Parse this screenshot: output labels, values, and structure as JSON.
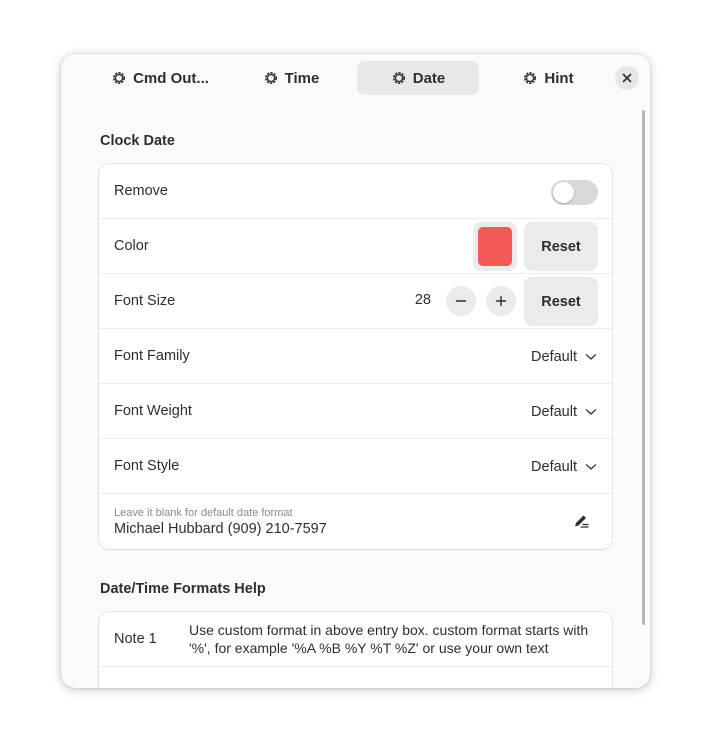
{
  "tabs": [
    {
      "label": "Cmd Out...",
      "icon": "gear-icon",
      "active": false
    },
    {
      "label": "Time",
      "icon": "gear-icon",
      "active": false
    },
    {
      "label": "Date",
      "icon": "gear-icon",
      "active": true
    },
    {
      "label": "Hint",
      "icon": "gear-icon",
      "active": false
    }
  ],
  "clock_date": {
    "title": "Clock Date",
    "remove_label": "Remove",
    "remove_enabled": false,
    "color_label": "Color",
    "color_value": "#f25a55",
    "reset_label": "Reset",
    "font_size_label": "Font Size",
    "font_size_value": "28",
    "font_family_label": "Font Family",
    "font_family_value": "Default",
    "font_weight_label": "Font Weight",
    "font_weight_value": "Default",
    "font_style_label": "Font Style",
    "font_style_value": "Default",
    "format_hint": "Leave it blank for default date format",
    "format_value": "Michael Hubbard (909) 210-7597"
  },
  "help": {
    "title": "Date/Time Formats Help",
    "notes": [
      {
        "label": "Note 1",
        "text": "Use custom format in above entry box. custom format starts with '%', for example '%A %B %Y %T %Z' or use your own text"
      }
    ]
  },
  "colors": {
    "accent_swatch": "#f25a55",
    "window_bg": "#fafafa",
    "button_bg": "#ebebeb"
  }
}
